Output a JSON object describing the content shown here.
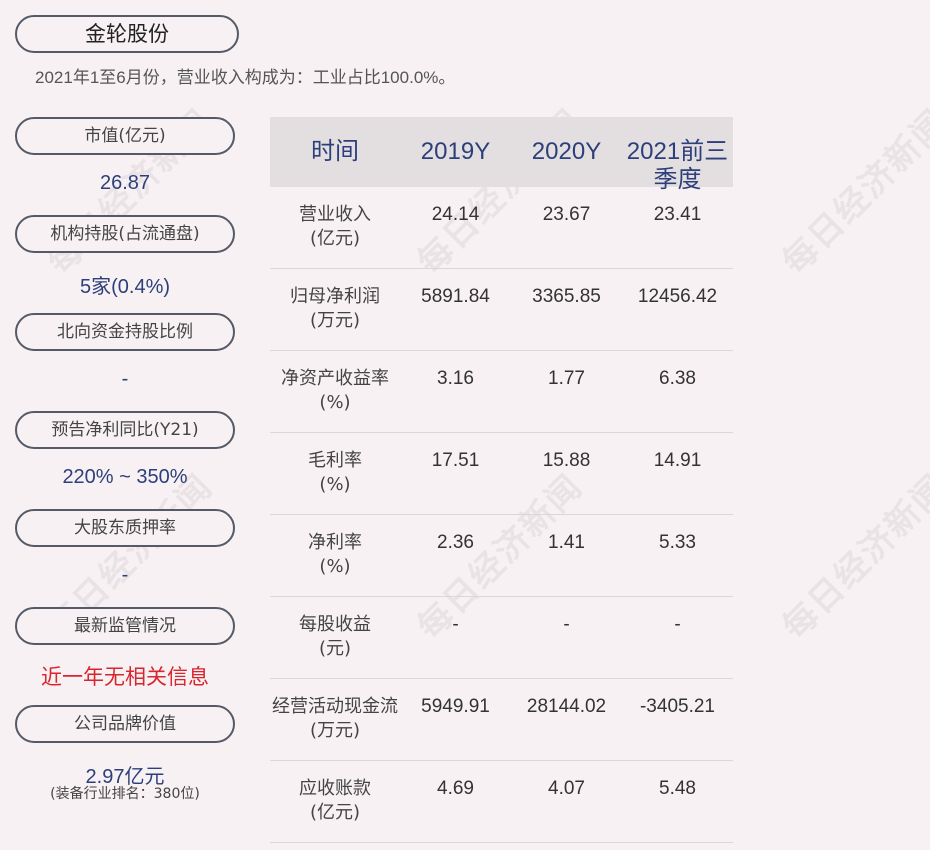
{
  "company": "金轮股份",
  "subtitle": "2021年1至6月份，营业收入构成为：工业占比100.0%。",
  "watermark": "每日经济新闻",
  "sidebar": [
    {
      "label": "市值(亿元)",
      "value": "26.87"
    },
    {
      "label": "机构持股(占流通盘)",
      "value": "5家(0.4%)"
    },
    {
      "label": "北向资金持股比例",
      "value": "-"
    },
    {
      "label": "预告净利同比(Y21)",
      "value": "220% ~ 350%"
    },
    {
      "label": "大股东质押率",
      "value": "-"
    },
    {
      "label": "最新监管情况",
      "value": "近一年无相关信息"
    },
    {
      "label": "公司品牌价值",
      "value": "2.97亿元",
      "sub": "(装备行业排名：380位)"
    }
  ],
  "table": {
    "headers": [
      "时间",
      "2019Y",
      "2020Y",
      "2021前三季度"
    ],
    "rows": [
      {
        "label1": "营业收入",
        "label2": "(亿元)",
        "v": [
          "24.14",
          "23.67",
          "23.41"
        ]
      },
      {
        "label1": "归母净利润",
        "label2": "(万元)",
        "v": [
          "5891.84",
          "3365.85",
          "12456.42"
        ]
      },
      {
        "label1": "净资产收益率",
        "label2": "(%)",
        "v": [
          "3.16",
          "1.77",
          "6.38"
        ]
      },
      {
        "label1": "毛利率",
        "label2": "(%)",
        "v": [
          "17.51",
          "15.88",
          "14.91"
        ]
      },
      {
        "label1": "净利率",
        "label2": "(%)",
        "v": [
          "2.36",
          "1.41",
          "5.33"
        ]
      },
      {
        "label1": "每股收益",
        "label2": "(元)",
        "v": [
          "-",
          "-",
          "-"
        ]
      },
      {
        "label1": "经营活动现金流",
        "label2": "(万元)",
        "v": [
          "5949.91",
          "28144.02",
          "-3405.21"
        ]
      },
      {
        "label1": "应收账款",
        "label2": "(亿元)",
        "v": [
          "4.69",
          "4.07",
          "5.48"
        ]
      }
    ]
  },
  "colors": {
    "accent": "#2d3f7a",
    "alert": "#d7262d",
    "background": "#f7f1f3",
    "header": "#e3dfe1"
  }
}
